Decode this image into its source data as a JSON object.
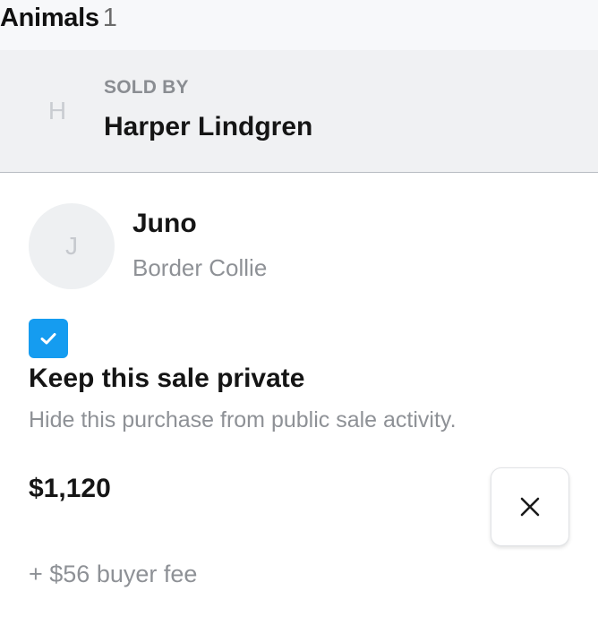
{
  "header": {
    "title": "Animals",
    "count": "1"
  },
  "seller": {
    "avatar_initial": "H",
    "label": "SOLD BY",
    "name": "Harper Lindgren"
  },
  "animal": {
    "avatar_initial": "J",
    "name": "Juno",
    "breed": "Border Collie"
  },
  "privacy": {
    "checked": true,
    "title": "Keep this sale private",
    "description": "Hide this purchase from public sale activity."
  },
  "pricing": {
    "price": "$1,120",
    "fee": "+ $56 buyer fee"
  },
  "icons": {
    "checkbox": "check-icon",
    "remove": "close-icon"
  },
  "colors": {
    "accent": "#159cf0"
  }
}
